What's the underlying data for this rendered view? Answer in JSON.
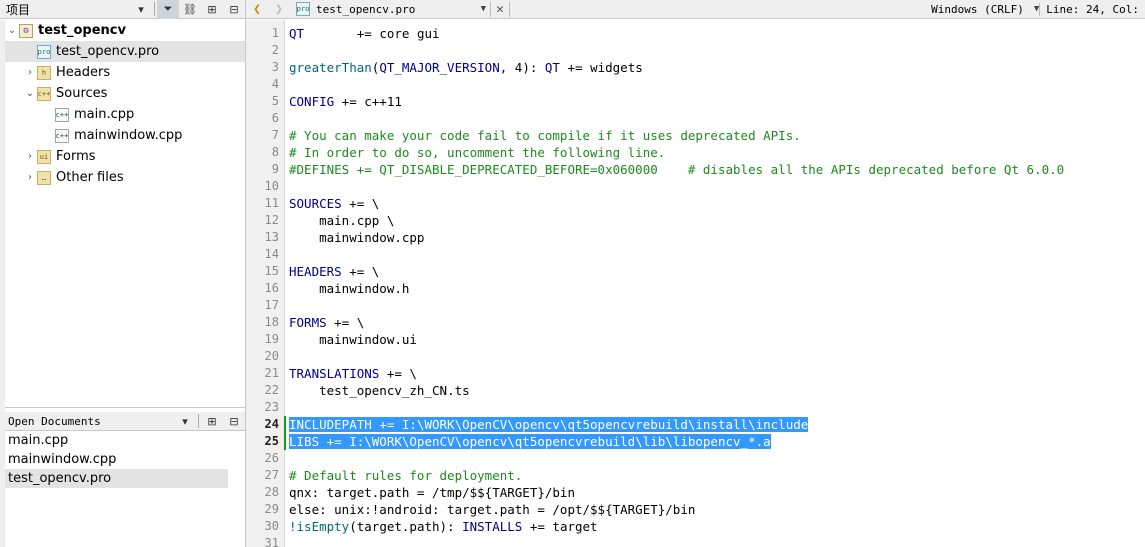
{
  "project_panel": {
    "title": "项目",
    "tree": [
      {
        "label": "test_opencv",
        "level": 0,
        "expanded": true,
        "icon": "project-icon",
        "bold": true
      },
      {
        "label": "test_opencv.pro",
        "level": 1,
        "icon": "pro-file-icon",
        "selected": true
      },
      {
        "label": "Headers",
        "level": 1,
        "expanded": false,
        "icon": "headers-folder-icon"
      },
      {
        "label": "Sources",
        "level": 1,
        "expanded": true,
        "icon": "sources-folder-icon"
      },
      {
        "label": "main.cpp",
        "level": 2,
        "icon": "cpp-file-icon"
      },
      {
        "label": "mainwindow.cpp",
        "level": 2,
        "icon": "cpp-file-icon"
      },
      {
        "label": "Forms",
        "level": 1,
        "expanded": false,
        "icon": "forms-folder-icon"
      },
      {
        "label": "Other files",
        "level": 1,
        "expanded": false,
        "icon": "other-folder-icon"
      }
    ]
  },
  "open_documents": {
    "title": "Open Documents",
    "items": [
      {
        "label": "main.cpp"
      },
      {
        "label": "mainwindow.cpp"
      },
      {
        "label": "test_opencv.pro",
        "selected": true
      }
    ]
  },
  "editor": {
    "file_name": "test_opencv.pro",
    "line_ending": "Windows (CRLF)",
    "cursor_position": "Line: 24, Col:",
    "current_line_numbers": [
      24,
      25
    ],
    "lines": [
      [
        {
          "t": "QT",
          "c": "kw"
        },
        {
          "t": "       += core gui"
        }
      ],
      [],
      [
        {
          "t": "greaterThan",
          "c": "fn"
        },
        {
          "t": "("
        },
        {
          "t": "QT_MAJOR_VERSION",
          "c": "kw"
        },
        {
          "t": ", 4): "
        },
        {
          "t": "QT",
          "c": "kw"
        },
        {
          "t": " += widgets"
        }
      ],
      [],
      [
        {
          "t": "CONFIG",
          "c": "kw"
        },
        {
          "t": " += c++11"
        }
      ],
      [],
      [
        {
          "t": "# You can make your code fail to compile if it uses deprecated APIs.",
          "c": "cm"
        }
      ],
      [
        {
          "t": "# In order to do so, uncomment the following line.",
          "c": "cm"
        }
      ],
      [
        {
          "t": "#DEFINES += QT_DISABLE_DEPRECATED_BEFORE=0x060000    # disables all the APIs deprecated before Qt 6.0.0",
          "c": "cm"
        }
      ],
      [],
      [
        {
          "t": "SOURCES",
          "c": "kw"
        },
        {
          "t": " += \\"
        }
      ],
      [
        {
          "t": "    main.cpp \\"
        }
      ],
      [
        {
          "t": "    mainwindow.cpp"
        }
      ],
      [],
      [
        {
          "t": "HEADERS",
          "c": "kw"
        },
        {
          "t": " += \\"
        }
      ],
      [
        {
          "t": "    mainwindow.h"
        }
      ],
      [],
      [
        {
          "t": "FORMS",
          "c": "kw"
        },
        {
          "t": " += \\"
        }
      ],
      [
        {
          "t": "    mainwindow.ui"
        }
      ],
      [],
      [
        {
          "t": "TRANSLATIONS",
          "c": "kw"
        },
        {
          "t": " += \\"
        }
      ],
      [
        {
          "t": "    test_opencv_zh_CN.ts"
        }
      ],
      [],
      [
        {
          "t": "INCLUDEPATH += I:\\WORK\\OpenCV\\opencv\\qt5opencvrebuild\\install\\include",
          "c": "hl"
        }
      ],
      [
        {
          "t": "LIBS += I:\\WORK\\OpenCV\\opencv\\qt5opencvrebuild\\lib\\libopencv_*.a",
          "c": "hl"
        }
      ],
      [],
      [
        {
          "t": "# Default rules for deployment.",
          "c": "cm"
        }
      ],
      [
        {
          "t": "qnx: target.path = /tmp/$${TARGET}/bin"
        }
      ],
      [
        {
          "t": "else: unix:!android: target.path = /opt/$${TARGET}/bin"
        }
      ],
      [
        {
          "t": "!isEmpty",
          "c": "fn"
        },
        {
          "t": "(target.path): "
        },
        {
          "t": "INSTALLS",
          "c": "kw"
        },
        {
          "t": " += target"
        }
      ],
      []
    ]
  },
  "colors": {
    "selection": "#3399ff",
    "keyword": "#00008b",
    "comment": "#1e8a1e",
    "change_marker": "#0fa00f"
  }
}
